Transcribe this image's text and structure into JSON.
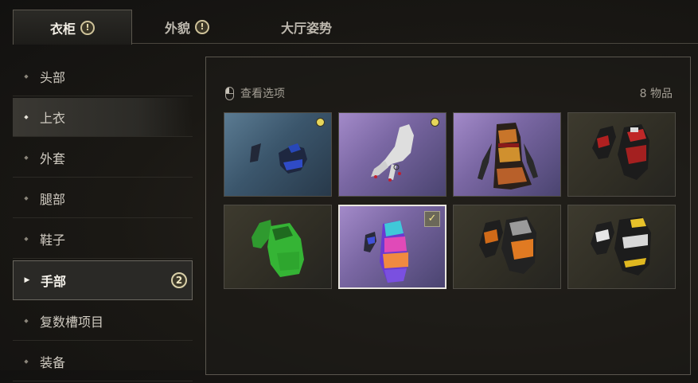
{
  "tabs": [
    {
      "label": "衣柜",
      "alert": "!"
    },
    {
      "label": "外貌",
      "alert": "!"
    },
    {
      "label": "大厅姿势"
    }
  ],
  "sidebar": {
    "items": [
      {
        "label": "头部"
      },
      {
        "label": "上衣"
      },
      {
        "label": "外套"
      },
      {
        "label": "腿部"
      },
      {
        "label": "鞋子"
      },
      {
        "label": "手部",
        "badge": "2"
      },
      {
        "label": "复数槽项目"
      },
      {
        "label": "装备"
      }
    ],
    "selected": "手部"
  },
  "panel": {
    "view_label": "查看选项",
    "item_count": "8 物品"
  },
  "items": [
    {
      "name": "blue fingerless gloves",
      "new": true
    },
    {
      "name": "white lace gloves",
      "new": true
    },
    {
      "name": "floral red sleeve gloves"
    },
    {
      "name": "red black racing gloves"
    },
    {
      "name": "green gloves"
    },
    {
      "name": "rainbow gradient gloves",
      "equipped": true
    },
    {
      "name": "orange black tactical gloves"
    },
    {
      "name": "yellow black tactical gloves"
    }
  ]
}
